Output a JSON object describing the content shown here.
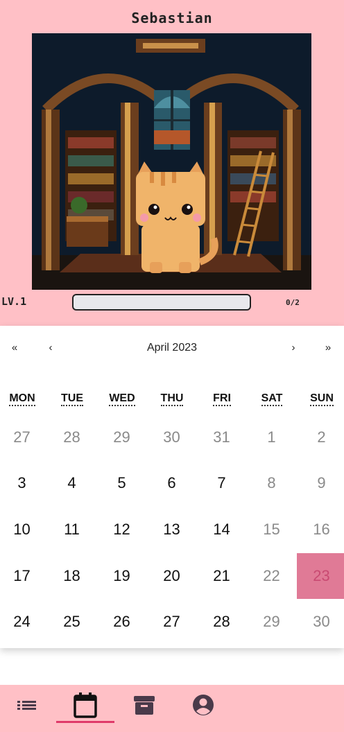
{
  "pet": {
    "name": "Sebastian",
    "level_label": "LV.1",
    "xp_text": "0/2",
    "xp_progress": 0
  },
  "calendar": {
    "month_label": "April 2023",
    "nav": {
      "prev_year": "«",
      "prev_month": "‹",
      "next_month": "›",
      "next_year": "»"
    },
    "weekdays": [
      "MON",
      "TUE",
      "WED",
      "THU",
      "FRI",
      "SAT",
      "SUN"
    ],
    "weeks": [
      [
        "27",
        "28",
        "29",
        "30",
        "31",
        "1",
        "2"
      ],
      [
        "3",
        "4",
        "5",
        "6",
        "7",
        "8",
        "9"
      ],
      [
        "10",
        "11",
        "12",
        "13",
        "14",
        "15",
        "16"
      ],
      [
        "17",
        "18",
        "19",
        "20",
        "21",
        "22",
        "23"
      ],
      [
        "24",
        "25",
        "26",
        "27",
        "28",
        "29",
        "30"
      ]
    ],
    "selected": "23"
  },
  "bottom_nav": {
    "tabs": [
      {
        "icon": "list-icon",
        "active": false
      },
      {
        "icon": "calendar-icon",
        "active": true
      },
      {
        "icon": "archive-icon",
        "active": false
      },
      {
        "icon": "account-icon",
        "active": false
      }
    ]
  },
  "colors": {
    "pink_bg": "#ffc0c6",
    "selected_day": "#e07a96",
    "active_underline": "#e03a6a"
  }
}
